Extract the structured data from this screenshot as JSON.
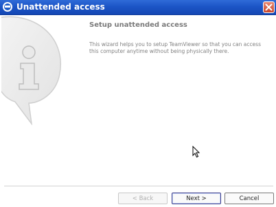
{
  "window": {
    "title": "Unattended access",
    "icons": {
      "app": "teamviewer-icon",
      "close": "close-icon",
      "graphic": "info-bubble-icon",
      "cursor": "mouse-pointer-icon"
    }
  },
  "wizard": {
    "heading": "Setup unattended access",
    "description": "This wizard helps you to setup TeamViewer so that you can access this computer anytime without being physically there."
  },
  "buttons": {
    "back": "< Back",
    "next": "Next >",
    "cancel": "Cancel"
  },
  "colors": {
    "titlebar": "#1c55c6",
    "close": "#d25a3a"
  }
}
